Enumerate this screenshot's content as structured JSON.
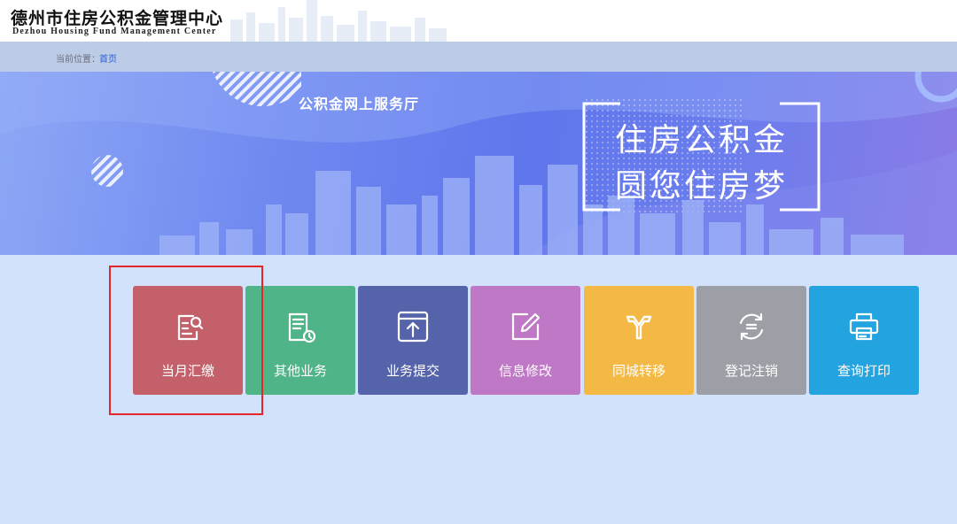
{
  "header": {
    "org_name_cn": "德州市住房公积金管理中心",
    "org_name_en": "Dezhou Housing Fund Management Center"
  },
  "breadcrumb": {
    "label": "当前位置：",
    "home": "首页"
  },
  "banner": {
    "title": "公积金网上服务厅",
    "slogan_line1": "住房公积金",
    "slogan_line2": "圆您住房梦"
  },
  "tiles": [
    {
      "label": "当月汇缴",
      "icon": "document-search-icon",
      "color": "#c4606a"
    },
    {
      "label": "其他业务",
      "icon": "document-clock-icon",
      "color": "#4fb487"
    },
    {
      "label": "业务提交",
      "icon": "upload-icon",
      "color": "#5563aa"
    },
    {
      "label": "信息修改",
      "icon": "edit-icon",
      "color": "#bf78c5"
    },
    {
      "label": "同城转移",
      "icon": "transfer-icon",
      "color": "#f3b944"
    },
    {
      "label": "登记注销",
      "icon": "cancel-icon",
      "color": "#9c9fa5"
    },
    {
      "label": "查询打印",
      "icon": "printer-icon",
      "color": "#23a3df"
    }
  ],
  "colors": {
    "page_bg": "#d2e2fb",
    "breadcrumb_bg": "#bccbe6",
    "highlight": "#e8242b"
  }
}
